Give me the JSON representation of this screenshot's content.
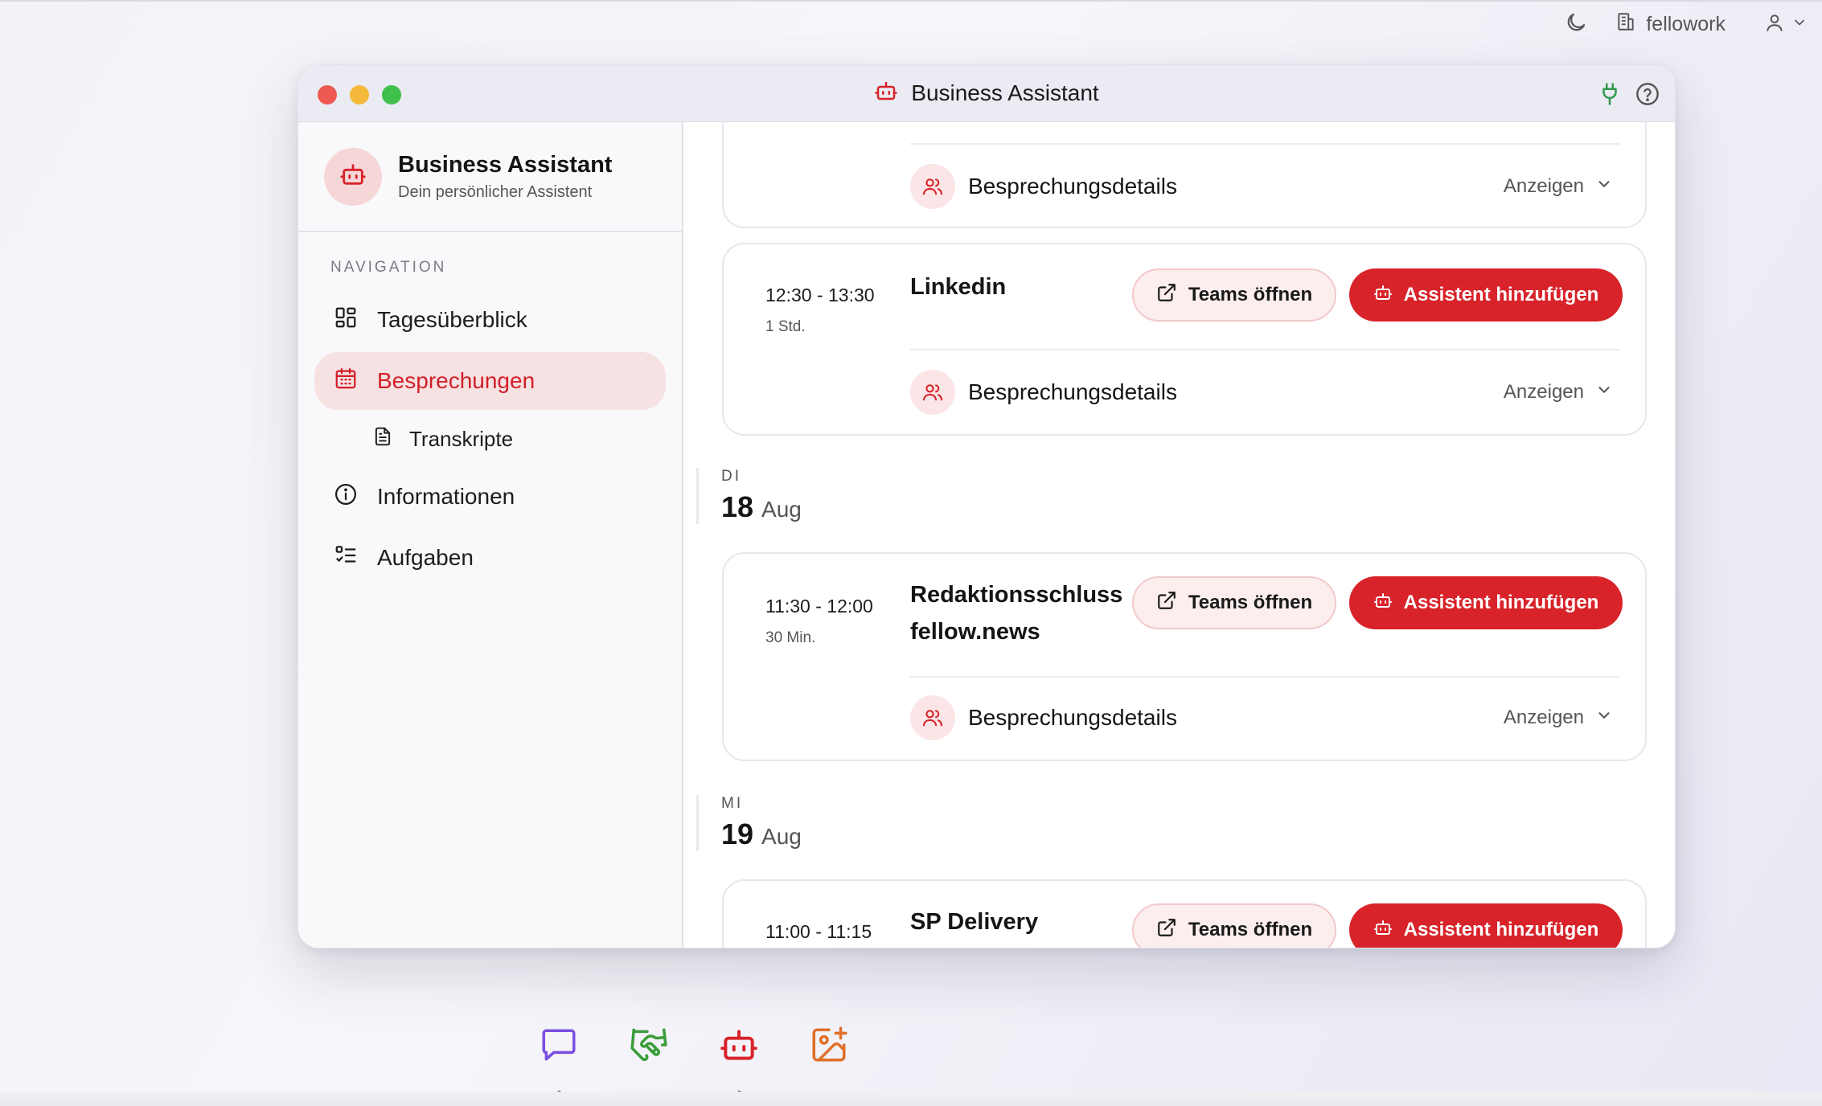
{
  "topbar": {
    "org_name": "fellowork"
  },
  "window": {
    "title": "Business Assistant"
  },
  "sidebar": {
    "brand_name": "Business Assistant",
    "brand_subtitle": "Dein persönlicher Assistent",
    "nav_label": "NAVIGATION",
    "items": [
      {
        "label": "Tagesüberblick"
      },
      {
        "label": "Besprechungen",
        "active": true
      },
      {
        "label": "Transkripte",
        "sub": true
      },
      {
        "label": "Informationen"
      },
      {
        "label": "Aufgaben"
      }
    ]
  },
  "main": {
    "labels": {
      "teams_button": "Teams öffnen",
      "assistant_button": "Assistent hinzufügen",
      "details_label": "Besprechungsdetails",
      "details_toggle": "Anzeigen"
    },
    "meetings": [
      {
        "time": "12:30 - 13:30",
        "duration": "1 Std.",
        "title": "Linkedin"
      },
      {
        "time": "11:30 - 12:00",
        "duration": "30 Min.",
        "title_line1": "Redaktionsschluss",
        "title_line2": "fellow.news"
      },
      {
        "time": "11:00 - 11:15",
        "title": "SP Delivery"
      }
    ],
    "days": [
      {
        "abbr": "DI",
        "day": "18",
        "month": "Aug"
      },
      {
        "abbr": "MI",
        "day": "19",
        "month": "Aug"
      }
    ]
  },
  "colors": {
    "accent": "#d8232a",
    "accent_soft": "#f6e1e3",
    "dock_chat": "#7a4fe0",
    "dock_handshake": "#3a9d3a",
    "dock_bot": "#d8232a",
    "dock_image": "#e0702a"
  }
}
